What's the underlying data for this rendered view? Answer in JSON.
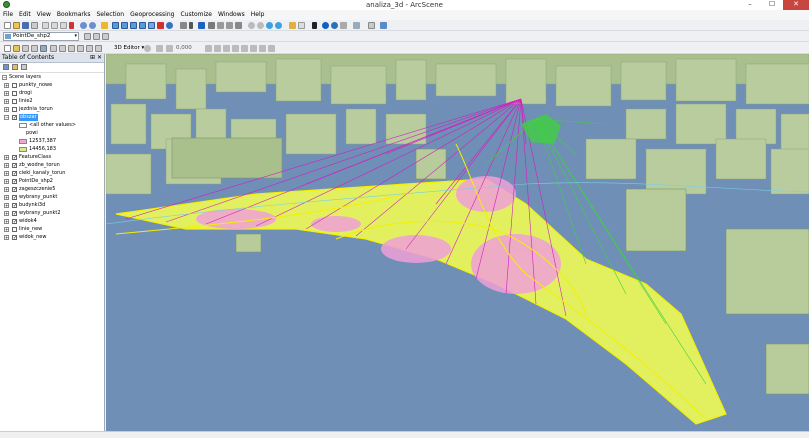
{
  "window": {
    "title": "analiza_3d - ArcScene",
    "minimize": "–",
    "maximize": "☐",
    "close": "✕"
  },
  "menu": [
    "File",
    "Edit",
    "View",
    "Bookmarks",
    "Selection",
    "Geoprocessing",
    "Customize",
    "Windows",
    "Help"
  ],
  "toolbar": {
    "layer_selector": "PointDe_shp2",
    "scene3d_editor": "3D Editor ▾",
    "scene3d_value": "0,000"
  },
  "toc": {
    "title": "Table of Contents",
    "pin": "⊞",
    "close": "✕",
    "root": "Scene layers",
    "layers": [
      {
        "name": "punkty_nowe",
        "checked": false
      },
      {
        "name": "drogi",
        "checked": false
      },
      {
        "name": "linie2",
        "checked": false
      },
      {
        "name": "jezdnia_torun",
        "checked": false
      },
      {
        "name": "obszar",
        "checked": true,
        "selected": true
      },
      {
        "name": "FeatureClass",
        "checked": true
      },
      {
        "name": "zb_wodne_torun",
        "checked": true
      },
      {
        "name": "cieki_kanaly_torun",
        "checked": true
      },
      {
        "name": "PointDe_shp2",
        "checked": true
      },
      {
        "name": "zageszczenie5",
        "checked": true
      },
      {
        "name": "wybrany_punkt",
        "checked": true
      },
      {
        "name": "budynki3d",
        "checked": true
      },
      {
        "name": "wybrany_punkt2",
        "checked": true
      },
      {
        "name": "widok4",
        "checked": true
      },
      {
        "name": "linie_new",
        "checked": false
      },
      {
        "name": "widok_new",
        "checked": true
      }
    ],
    "legend": {
      "other": "<all other values>",
      "field": "powi",
      "classes": [
        {
          "label": "12537,387",
          "color": "#f0a6d6"
        },
        {
          "label": "14456,183",
          "color": "#d6ec84"
        }
      ]
    }
  },
  "colors": {
    "sky": "#6f8fb6",
    "building": "#b7cc9a",
    "surface": "#e2f060",
    "pink": "#f0a0d8",
    "sightline_magenta": "#d020c0",
    "sightline_green": "#40d040"
  }
}
